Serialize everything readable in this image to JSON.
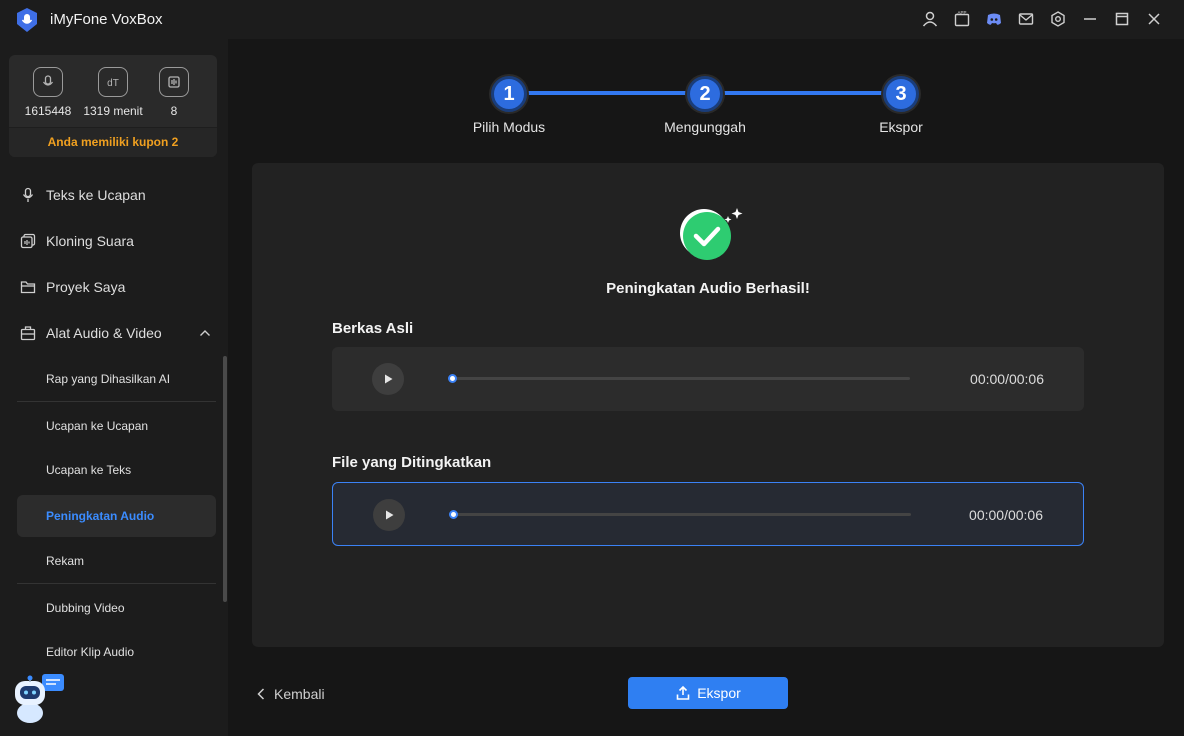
{
  "app": {
    "title": "iMyFone VoxBox"
  },
  "titlebar": {
    "icons": [
      "user-icon",
      "app-icon",
      "discord-icon",
      "mail-icon",
      "settings-icon",
      "minimize-icon",
      "maximize-icon",
      "close-icon"
    ]
  },
  "stats": {
    "characters": "1615448",
    "minutes": "1319 menit",
    "count": "8",
    "coupon": "Anda memiliki kupon 2"
  },
  "sidebar": {
    "nav": [
      {
        "label": "Teks ke Ucapan",
        "icon": "microphone-icon"
      },
      {
        "label": "Kloning Suara",
        "icon": "voice-clone-icon"
      },
      {
        "label": "Proyek Saya",
        "icon": "folder-icon"
      },
      {
        "label": "Alat Audio & Video",
        "icon": "toolbox-icon"
      }
    ],
    "sub": [
      {
        "label": "Rap yang Dihasilkan AI"
      },
      {
        "label": "Ucapan ke Ucapan"
      },
      {
        "label": "Ucapan ke Teks"
      },
      {
        "label": "Peningkatan Audio"
      },
      {
        "label": "Rekam"
      },
      {
        "label": "Dubbing Video"
      },
      {
        "label": "Editor Klip Audio"
      }
    ],
    "active_sub": "Peningkatan Audio"
  },
  "steps": [
    {
      "num": "1",
      "label": "Pilih Modus"
    },
    {
      "num": "2",
      "label": "Mengunggah"
    },
    {
      "num": "3",
      "label": "Ekspor"
    }
  ],
  "result": {
    "message": "Peningkatan Audio Berhasil!",
    "original_title": "Berkas Asli",
    "original_time": "00:00/00:06",
    "enhanced_title": "File yang Ditingkatkan",
    "enhanced_time": "00:00/00:06",
    "progress": 0
  },
  "footer": {
    "back_label": "Kembali",
    "export_label": "Ekspor"
  },
  "colors": {
    "accent": "#2f7ff2",
    "coupon": "#f0a020",
    "success": "#2ecc71",
    "active_nav": "#3b8cff"
  }
}
